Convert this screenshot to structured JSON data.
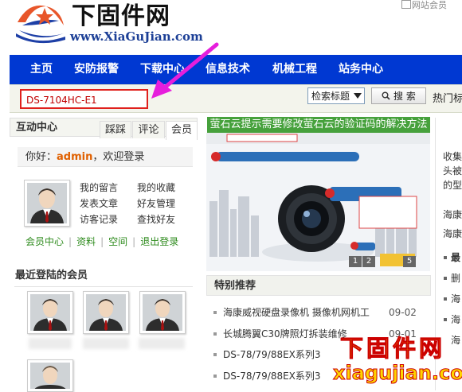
{
  "site": {
    "logo_cn": "下固件网",
    "logo_en": "www.XiaGuJian.com",
    "member_image_alt": "网站会员"
  },
  "nav": {
    "items": [
      "主页",
      "安防报警",
      "下载中心",
      "信息技术",
      "机械工程",
      "站务中心"
    ]
  },
  "search": {
    "value": "DS-7104HC-E1",
    "select_value": "检索标题",
    "button_label": "搜 索",
    "hot_label": "热门标"
  },
  "left": {
    "title": "互动中心",
    "tabs": [
      "踩踩",
      "评论",
      "会员"
    ],
    "greeting_prefix": "你好：",
    "username": "admin",
    "greeting_suffix": "，欢迎登录",
    "links": [
      "我的留言",
      "我的收藏",
      "发表文章",
      "好友管理",
      "访客记录",
      "查找好友"
    ],
    "member_links": [
      "会员中心",
      "资料",
      "空间",
      "退出登录"
    ],
    "recent_title": "最近登陆的会员"
  },
  "middle": {
    "feature_title": "萤石云提示需要修改萤石云的验证码的解决方法",
    "slide_numbers": [
      "1",
      "2",
      "3",
      "4",
      "5"
    ],
    "special_title": "特别推荐",
    "news": [
      {
        "title": "海康威视硬盘录像机 摄像机网机工",
        "date": "09-02"
      },
      {
        "title": "长城腾翼C30牌照灯拆装维修",
        "date": "09-01"
      },
      {
        "title": "DS-78/79/88EX系列3",
        "date": ""
      },
      {
        "title": "DS-78/79/88EX系列3",
        "date": ""
      }
    ]
  },
  "right": {
    "lines": [
      "收集",
      "头被",
      "的型",
      "海康",
      "海康",
      "最",
      "删",
      "海",
      "海",
      "海"
    ]
  },
  "watermark": {
    "cn": "下固件网",
    "en": "xiagujian.com"
  },
  "colors": {
    "nav_blue": "#0038d2",
    "feature_green": "#46a13c",
    "search_red_border": "#e0201c",
    "username_orange": "#e06000",
    "arrow_magenta": "#e61edc"
  }
}
